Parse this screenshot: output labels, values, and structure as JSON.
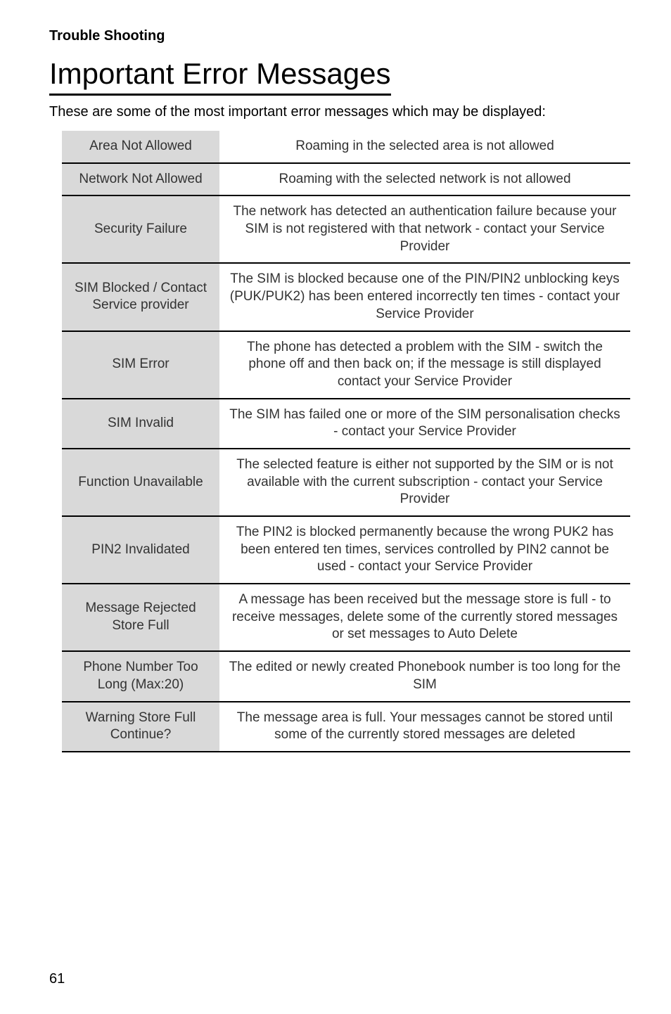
{
  "section_label": "Trouble Shooting",
  "page_title": "Important Error Messages",
  "intro": "These are some of the most important error messages which may be displayed:",
  "rows": [
    {
      "name": "Area Not Allowed",
      "desc": "Roaming in the selected area is not allowed"
    },
    {
      "name": "Network Not Allowed",
      "desc": "Roaming with the selected network is not allowed"
    },
    {
      "name": "Security Failure",
      "desc": "The network has detected an authentication failure because your SIM is not registered with that network - contact your Service Provider"
    },
    {
      "name": "SIM Blocked / Contact Service provider",
      "desc": "The SIM is blocked because one of the PIN/PIN2 unblocking keys (PUK/PUK2) has been entered incorrectly ten times - contact your Service Provider"
    },
    {
      "name": "SIM Error",
      "desc": "The phone has detected a problem with the SIM - switch the phone off and then back on; if the message is still displayed contact your Service Provider"
    },
    {
      "name": "SIM Invalid",
      "desc": "The SIM has failed one or more of the SIM personalisation checks - contact your Service Provider"
    },
    {
      "name": "Function Unavailable",
      "desc": "The selected feature is either not supported by the SIM or is not available with the current subscription - contact your Service Provider"
    },
    {
      "name": "PIN2 Invalidated",
      "desc": "The PIN2 is blocked permanently because the wrong PUK2 has been entered ten times, services controlled by PIN2 cannot be used - contact your Service Provider"
    },
    {
      "name": "Message Rejected Store Full",
      "desc": "A message has been received but the message store is full - to receive messages, delete some of the currently stored messages or set messages to Auto Delete"
    },
    {
      "name": "Phone Number Too Long (Max:20)",
      "desc": "The edited or newly created Phonebook number is too long for the SIM"
    },
    {
      "name": "Warning Store Full Continue?",
      "desc": "The message area is full. Your messages cannot be stored until some of the currently stored messages are deleted"
    }
  ],
  "page_number": "61"
}
